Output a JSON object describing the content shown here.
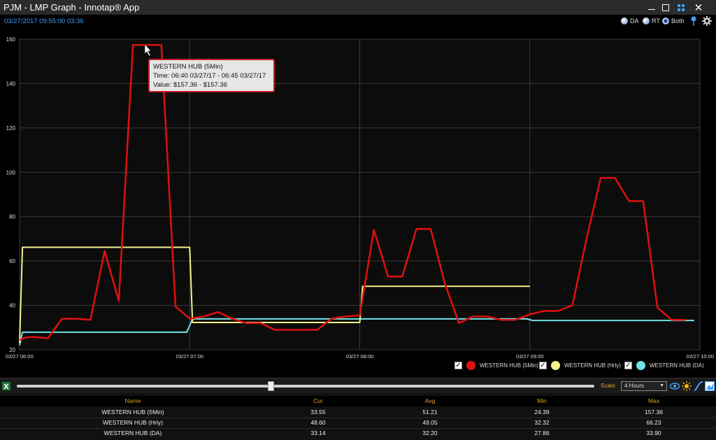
{
  "window": {
    "title": "PJM - LMP Graph - Innotap® App",
    "close_glyph": "✕"
  },
  "header": {
    "timestamp": "03/27/2017 09:55:00  03:36",
    "modes": [
      {
        "label": "DA",
        "selected": false
      },
      {
        "label": "RT",
        "selected": false
      },
      {
        "label": "Both",
        "selected": true
      }
    ],
    "icons": [
      "pin-icon",
      "gear-icon"
    ]
  },
  "tooltip": {
    "title": "WESTERN HUB (5Min)",
    "time": "Time: 06:40 03/27/17 - 06:45 03/27/17",
    "value": "Value: $157.36 - $157.36"
  },
  "legend": [
    {
      "checked": true,
      "check": "✓",
      "label": "WESTERN HUB (5Min)",
      "color": "#e01010"
    },
    {
      "checked": true,
      "check": "✓",
      "label": "WESTERN HUB (Hrly)",
      "color": "#f5f08a"
    },
    {
      "checked": true,
      "check": "✓",
      "label": "WESTERN HUB (DA)",
      "color": "#6fe3e8"
    }
  ],
  "controls": {
    "scale_label": "Scale:",
    "scale_value": "4 Hours",
    "slider_value": 0.44,
    "icons": [
      "excel-icon",
      "eye-icon",
      "sun-icon",
      "curve-icon",
      "chart-icon"
    ]
  },
  "stats": {
    "headers": [
      "Name",
      "Cur",
      "Avg",
      "Min",
      "Max"
    ],
    "rows": [
      [
        "WESTERN HUB (5Min)",
        "33.55",
        "51.21",
        "24.39",
        "157.36"
      ],
      [
        "WESTERN HUB (Hrly)",
        "48.60",
        "49.05",
        "32.32",
        "66.23"
      ],
      [
        "WESTERN HUB (DA)",
        "33.14",
        "32.20",
        "27.86",
        "33.90"
      ]
    ]
  },
  "chart_data": {
    "type": "line",
    "ylim": [
      20,
      160
    ],
    "yticks": [
      "20",
      "40",
      "60",
      "80",
      "100",
      "120",
      "140",
      "160"
    ],
    "xlim": [
      0,
      240
    ],
    "xticks": [
      {
        "t": 0,
        "label": "03/27 06:00"
      },
      {
        "t": 60,
        "label": "03/27 07:00"
      },
      {
        "t": 120,
        "label": "03/27 08:00"
      },
      {
        "t": 180,
        "label": "03/27 09:00"
      },
      {
        "t": 240,
        "label": "03/27 10:00"
      }
    ],
    "grid": true,
    "legend_position": "bottom-right",
    "series": [
      {
        "name": "WESTERN HUB (5Min)",
        "color": "#e01010",
        "points": [
          [
            0,
            24.4
          ],
          [
            2,
            25.5
          ],
          [
            5,
            25.8
          ],
          [
            10,
            25.2
          ],
          [
            15,
            34
          ],
          [
            20,
            34
          ],
          [
            25,
            33.5
          ],
          [
            30,
            64.5
          ],
          [
            35,
            42
          ],
          [
            40,
            157.4
          ],
          [
            45,
            157.4
          ],
          [
            50,
            157.4
          ],
          [
            55,
            39.5
          ],
          [
            60,
            34
          ],
          [
            65,
            35
          ],
          [
            70,
            37
          ],
          [
            75,
            34
          ],
          [
            80,
            32
          ],
          [
            85,
            32
          ],
          [
            90,
            29
          ],
          [
            95,
            29
          ],
          [
            100,
            29
          ],
          [
            105,
            29
          ],
          [
            110,
            34
          ],
          [
            115,
            35
          ],
          [
            120,
            35.5
          ],
          [
            125,
            74
          ],
          [
            130,
            53
          ],
          [
            135,
            53
          ],
          [
            140,
            74.5
          ],
          [
            145,
            74.5
          ],
          [
            150,
            50
          ],
          [
            155,
            32
          ],
          [
            160,
            35
          ],
          [
            165,
            35
          ],
          [
            170,
            33.5
          ],
          [
            175,
            33.5
          ],
          [
            180,
            36
          ],
          [
            185,
            37.5
          ],
          [
            190,
            37.5
          ],
          [
            195,
            40
          ],
          [
            200,
            70
          ],
          [
            205,
            97.5
          ],
          [
            210,
            97.5
          ],
          [
            215,
            87
          ],
          [
            220,
            87
          ],
          [
            225,
            39
          ],
          [
            230,
            33.5
          ],
          [
            235,
            33.5
          ]
        ]
      },
      {
        "name": "WESTERN HUB (Hrly)",
        "color": "#f5f08a",
        "points": [
          [
            0,
            23
          ],
          [
            1,
            66.2
          ],
          [
            60,
            66.2
          ],
          [
            61,
            32.3
          ],
          [
            120,
            32.3
          ],
          [
            121,
            48.6
          ],
          [
            180,
            48.6
          ]
        ]
      },
      {
        "name": "WESTERN HUB (DA)",
        "color": "#6fe3e8",
        "points": [
          [
            0,
            22
          ],
          [
            1,
            27.9
          ],
          [
            59,
            27.9
          ],
          [
            61,
            33.9
          ],
          [
            179,
            33.9
          ],
          [
            181,
            33.2
          ],
          [
            238,
            33.2
          ]
        ]
      }
    ]
  }
}
